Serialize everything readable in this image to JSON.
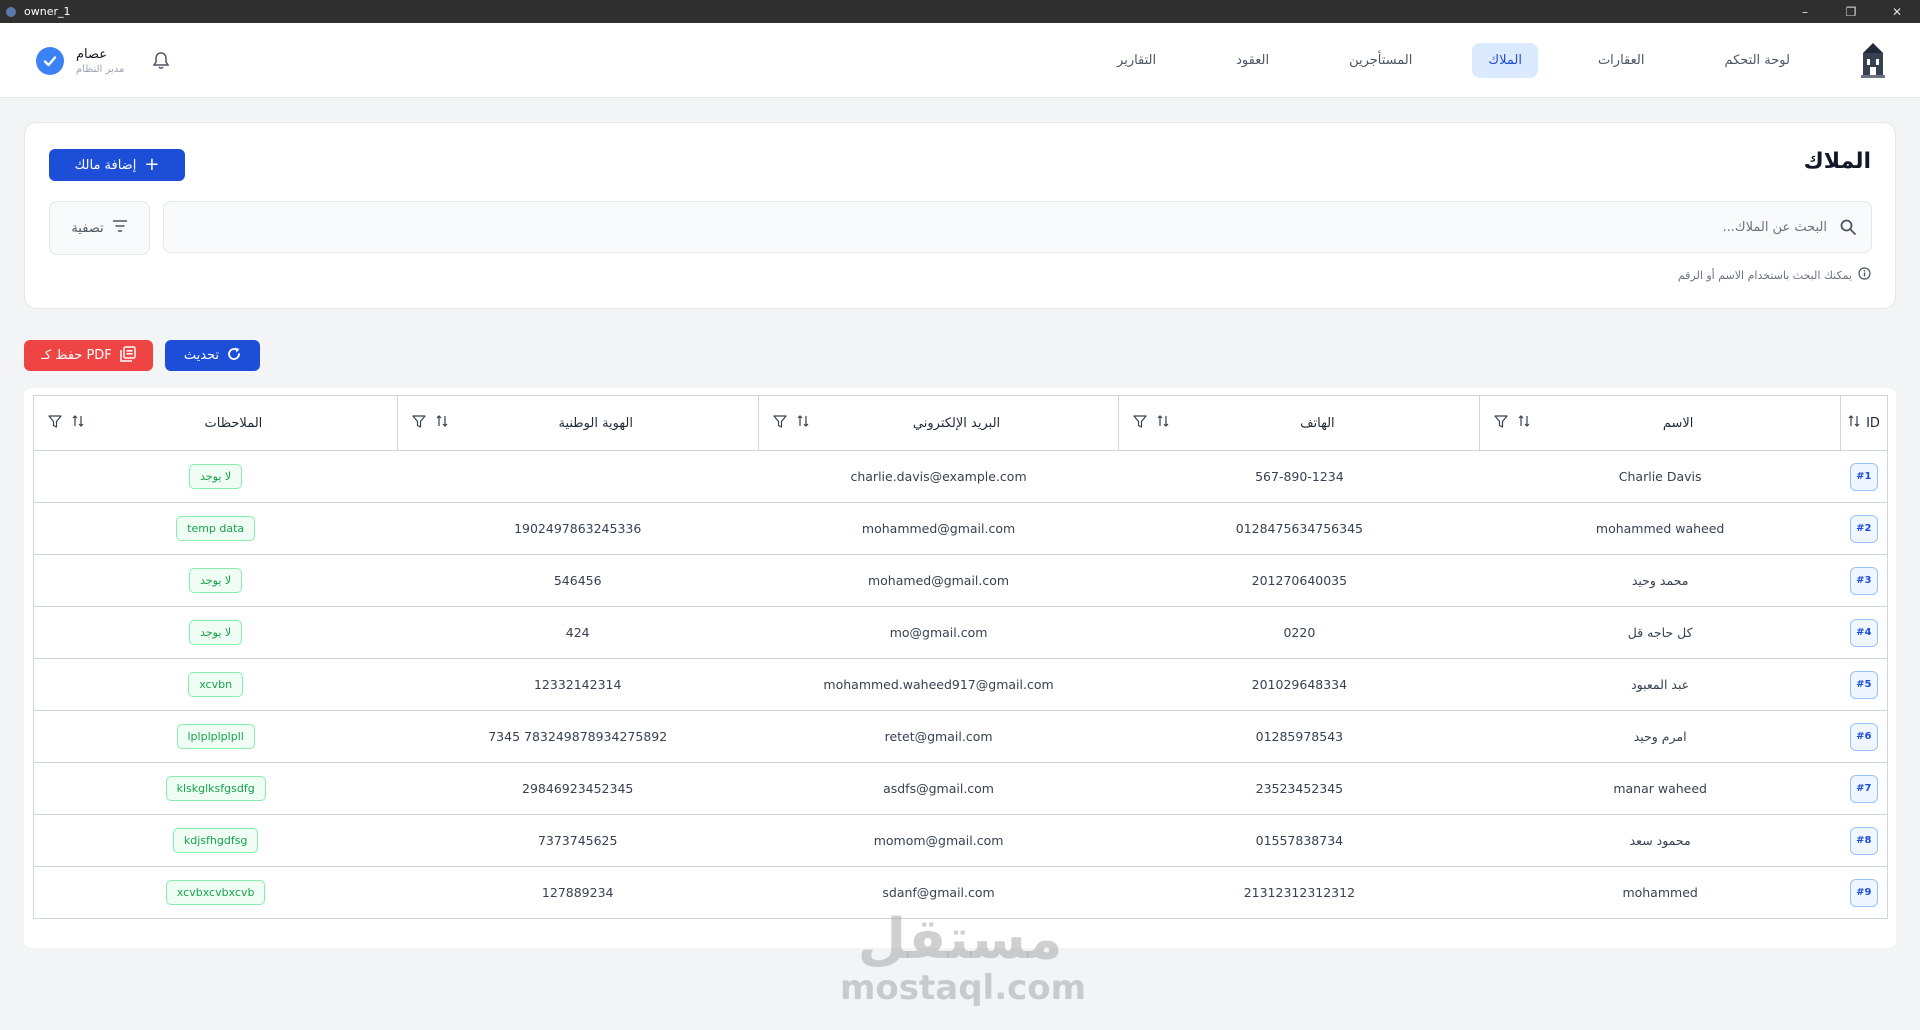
{
  "window": {
    "title": "owner_1",
    "minimize": "–",
    "maximize": "❐",
    "close": "✕"
  },
  "nav": {
    "items": [
      {
        "label": "لوحة التحكم",
        "active": false
      },
      {
        "label": "العقارات",
        "active": false
      },
      {
        "label": "الملاك",
        "active": true
      },
      {
        "label": "المستأجرين",
        "active": false
      },
      {
        "label": "العقود",
        "active": false
      },
      {
        "label": "التقارير",
        "active": false
      }
    ]
  },
  "user": {
    "name": "عصام",
    "role": "مدير النظام"
  },
  "header": {
    "title": "الملاك",
    "add_label": "إضافة مالك",
    "filter_label": "تصفية",
    "search_placeholder": "البحث عن الملاك...",
    "hint": "يمكنك البحث باستخدام الاسم أو الرقم"
  },
  "actions": {
    "pdf_label": "حفظ كـ PDF",
    "refresh_label": "تحديث"
  },
  "table": {
    "columns": {
      "id": "ID",
      "name": "الاسم",
      "phone": "الهاتف",
      "email": "البريد الإلكتروني",
      "national_id": "الهوية الوطنية",
      "notes": "الملاحظات"
    },
    "rows": [
      {
        "id": "#1",
        "name": "Charlie Davis",
        "phone": "567-890-1234",
        "email": "charlie.davis@example.com",
        "national_id": "",
        "notes": "لا يوجد"
      },
      {
        "id": "#2",
        "name": "mohammed waheed",
        "phone": "0128475634756345",
        "email": "mohammed@gmail.com",
        "national_id": "1902497863245336",
        "notes": "temp data"
      },
      {
        "id": "#3",
        "name": "محمد وحيد",
        "phone": "201270640035",
        "email": "mohamed@gmail.com",
        "national_id": "546456",
        "notes": "لا يوجد"
      },
      {
        "id": "#4",
        "name": "كل حاجه قل",
        "phone": "0220",
        "email": "mo@gmail.com",
        "national_id": "424",
        "notes": "لا يوجد"
      },
      {
        "id": "#5",
        "name": "عبد المعبود",
        "phone": "201029648334",
        "email": "mohammed.waheed917@gmail.com",
        "national_id": "12332142314",
        "notes": "xcvbn"
      },
      {
        "id": "#6",
        "name": "امرم وحيد",
        "phone": "01285978543",
        "email": "retet@gmail.com",
        "national_id": "783249878934275892 7345",
        "notes": "lplplplplpll"
      },
      {
        "id": "#7",
        "name": "manar waheed",
        "phone": "23523452345",
        "email": "asdfs@gmail.com",
        "national_id": "29846923452345",
        "notes": "klskglksfgsdfg"
      },
      {
        "id": "#8",
        "name": "محمود سعد",
        "phone": "01557838734",
        "email": "momom@gmail.com",
        "national_id": "7373745625",
        "notes": "kdjsfhgdfsg"
      },
      {
        "id": "#9",
        "name": "mohammed",
        "phone": "21312312312312",
        "email": "sdanf@gmail.com",
        "national_id": "127889234",
        "notes": "xcvbxcvbxcvb"
      }
    ]
  },
  "watermark": {
    "line1": "مستقل",
    "line2": "mostaql.com"
  },
  "colors": {
    "primary": "#1d4ed8",
    "danger": "#ef4444",
    "success": "#16a34a",
    "active_nav_bg": "#dbeafe"
  }
}
